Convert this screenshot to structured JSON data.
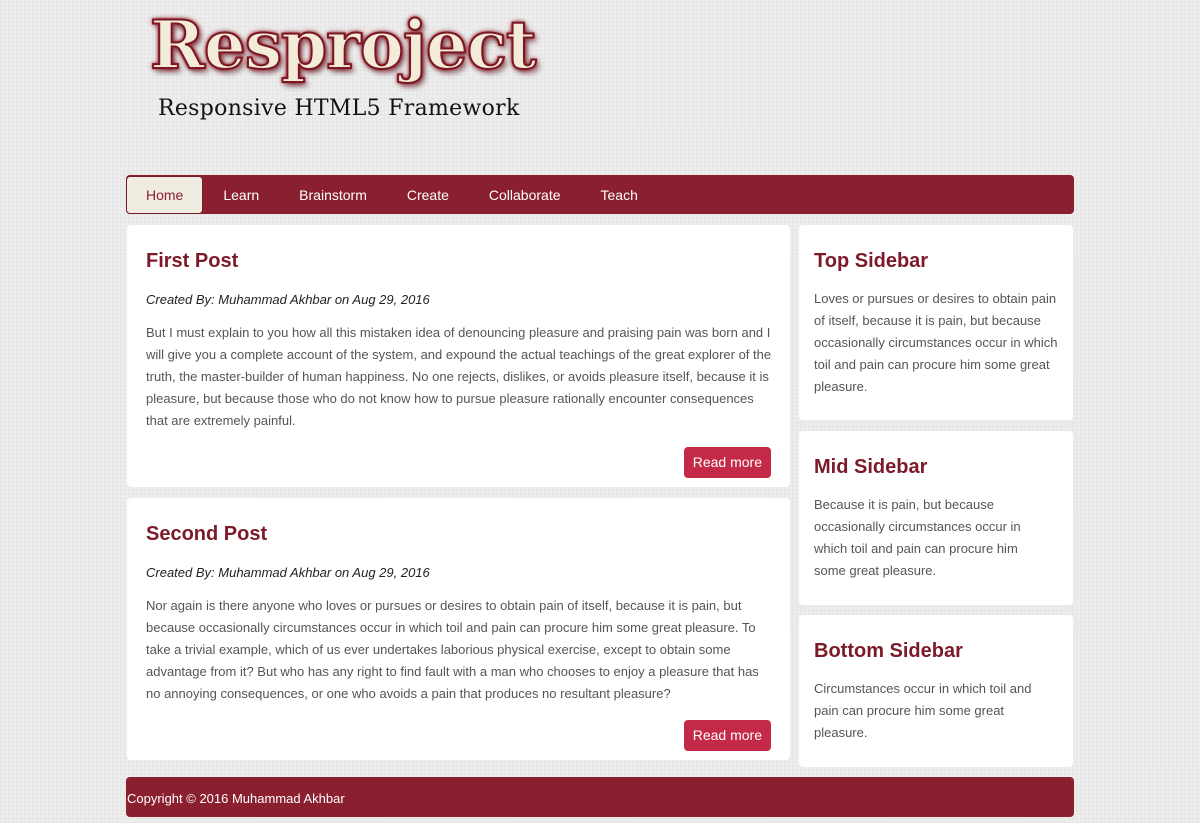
{
  "header": {
    "logo_text": "Resproject",
    "tagline": "Responsive HTML5 Framework"
  },
  "nav": {
    "items": [
      "Home",
      "Learn",
      "Brainstorm",
      "Create",
      "Collaborate",
      "Teach"
    ],
    "active": "Home"
  },
  "posts": [
    {
      "title": "First Post",
      "meta": "Created By: Muhammad Akhbar on Aug 29, 2016",
      "body": "But I must explain to you how all this mistaken idea of denouncing pleasure and praising pain was born and I will give you a complete account of the system, and expound the actual teachings of the great explorer of the truth, the master-builder of human happiness. No one rejects, dislikes, or avoids pleasure itself, because it is pleasure, but because those who do not know how to pursue pleasure rationally encounter consequences that are extremely painful.",
      "button": "Read more"
    },
    {
      "title": "Second Post",
      "meta": "Created By: Muhammad Akhbar on Aug 29, 2016",
      "body": "Nor again is there anyone who loves or pursues or desires to obtain pain of itself, because it is pain, but because occasionally circumstances occur in which toil and pain can procure him some great pleasure. To take a trivial example, which of us ever undertakes laborious physical exercise, except to obtain some advantage from it? But who has any right to find fault with a man who chooses to enjoy a pleasure that has no annoying consequences, or one who avoids a pain that produces no resultant pleasure?",
      "button": "Read more"
    }
  ],
  "sidebar": [
    {
      "title": "Top Sidebar",
      "body": "Loves or pursues or desires to obtain pain of itself, because it is pain, but because occasionally circumstances occur in which toil and pain can procure him some great pleasure."
    },
    {
      "title": "Mid Sidebar",
      "body": "Because it is pain, but because occasionally circumstances occur in which toil and pain can procure him some great pleasure."
    },
    {
      "title": "Bottom Sidebar",
      "body": "Circumstances occur in which toil and pain can procure him some great pleasure."
    }
  ],
  "footer": {
    "copyright": "Copyright © 2016 Muhammad Akhbar"
  },
  "colors": {
    "brand": "#8a1f2f",
    "button": "#c42a47",
    "heading": "#7c1a28"
  }
}
